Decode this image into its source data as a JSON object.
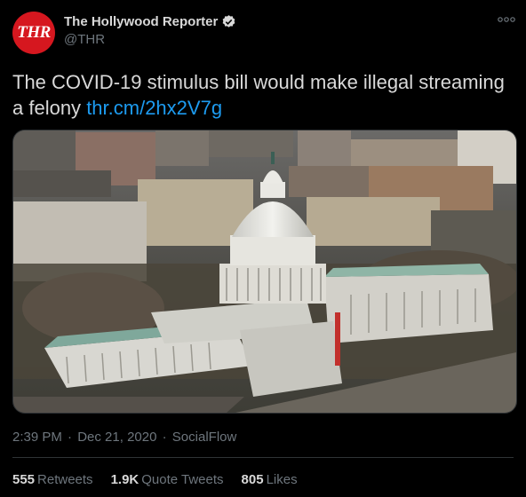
{
  "author": {
    "avatar_text": "THR",
    "display_name": "The Hollywood Reporter",
    "handle": "@THR"
  },
  "tweet": {
    "text": "The COVID-19 stimulus bill would make illegal streaming a felony",
    "link": "thr.cm/2hx2V7g"
  },
  "meta": {
    "time": "2:39 PM",
    "sep1": " · ",
    "date": "Dec 21, 2020",
    "sep2": " · ",
    "source": "SocialFlow"
  },
  "stats": {
    "retweets_count": "555",
    "retweets_label": "Retweets",
    "quotes_count": "1.9K",
    "quotes_label": "Quote Tweets",
    "likes_count": "805",
    "likes_label": "Likes"
  },
  "colors": {
    "background": "#000000",
    "link": "#1d9bf0",
    "avatar": "#d6171f",
    "verified": "#d9d9d9",
    "muted": "#6e767d"
  },
  "icons": {
    "more": "more-horizontal-icon",
    "verified": "verified-badge-icon"
  }
}
